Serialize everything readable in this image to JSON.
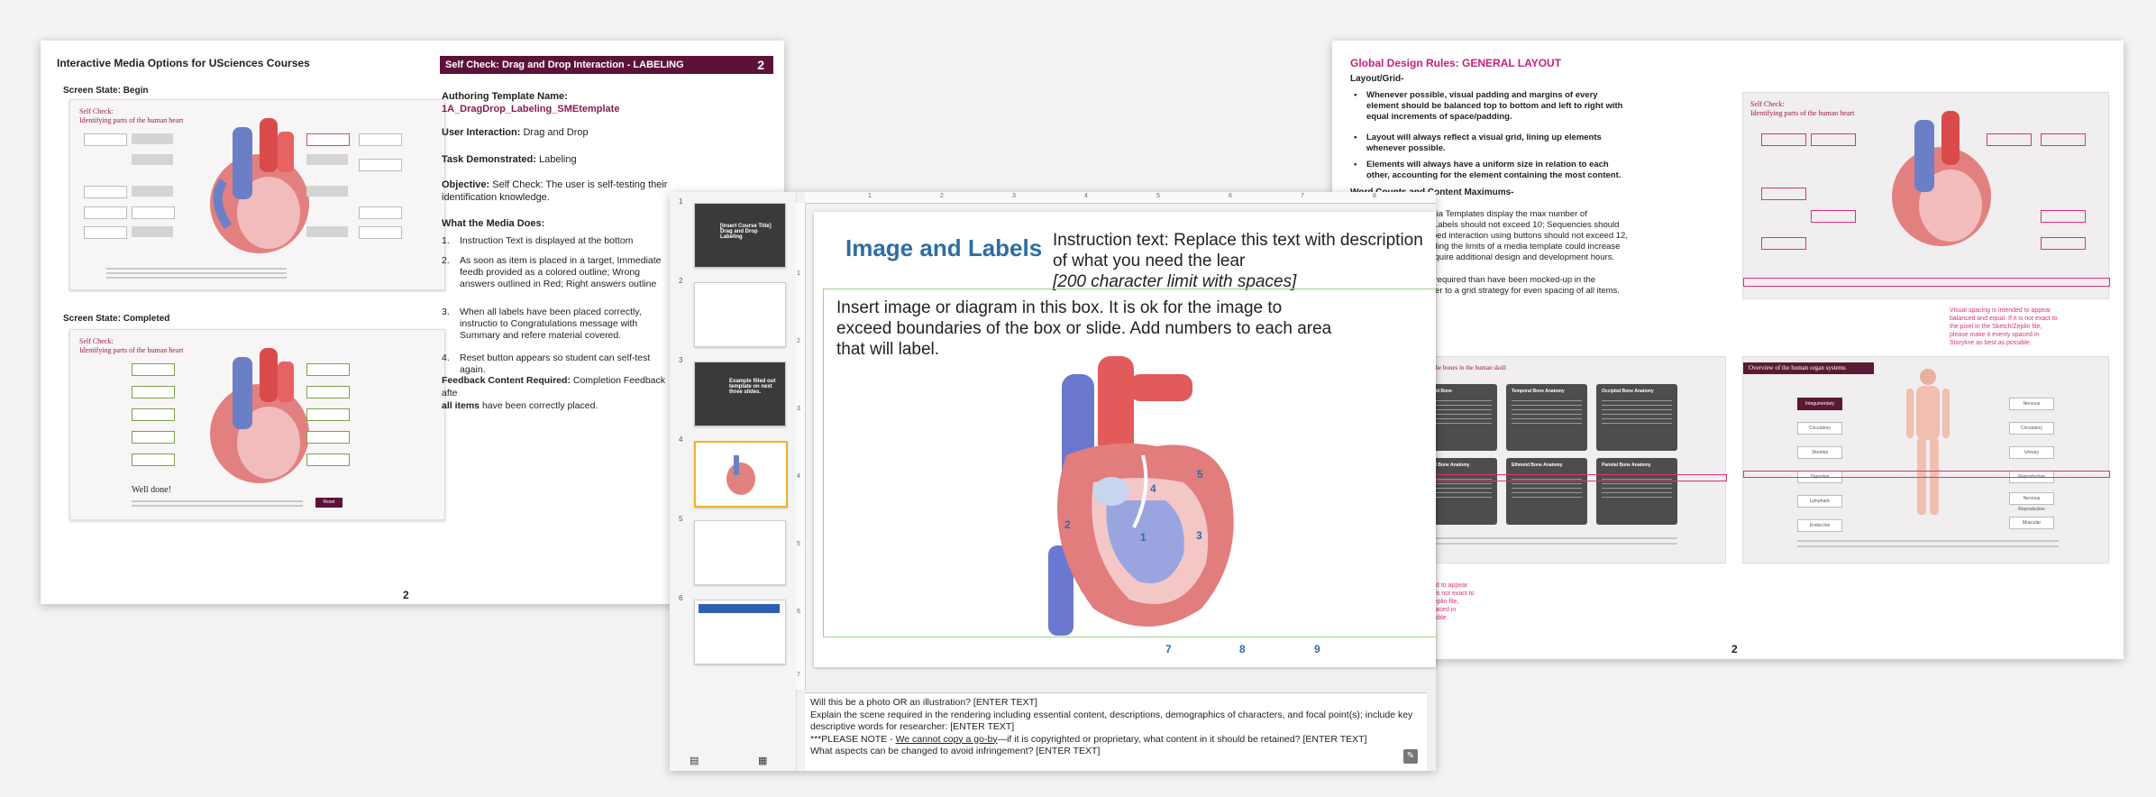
{
  "left_doc": {
    "title": "Interactive Media Options for USciences Courses",
    "screen_begin_label": "Screen State: Begin",
    "screen_completed_label": "Screen State: Completed",
    "thumb_title_line1": "Self Check:",
    "thumb_title_line2": "Identifying parts of the human heart",
    "well_done": "Well done!",
    "reset_label": "Reset",
    "section_header": "Self Check: Drag and Drop Interaction - LABELING",
    "section_number": "2",
    "authoring_label": "Authoring Template Name:",
    "authoring_value": "1A_DragDrop_Labeling_SMEtemplate",
    "user_interaction_label": "User Interaction:",
    "user_interaction_value": "Drag and Drop",
    "task_label": "Task Demonstrated:",
    "task_value": "Labeling",
    "objective_label": "Objective:",
    "objective_value": "Self Check: The user is self-testing their identification knowledge.",
    "media_does_label": "What the Media Does:",
    "list": [
      {
        "n": "1.",
        "text": "Instruction Text is displayed at the bottom"
      },
      {
        "n": "2.",
        "text": "As soon as item is placed in a target, Immediate feedb provided as a colored outline; Wrong answers outlined in Red; Right answers outline"
      },
      {
        "n": "3.",
        "text": "When all labels have been placed correctly, instructio to Congratulations message with Summary and refere material covered."
      },
      {
        "n": "4.",
        "text": "Reset button appears so student can self-test again."
      }
    ],
    "feedback_label": "Feedback Content Required:",
    "feedback_value": "Completion Feedback afte",
    "feedback_value2": "all items",
    "feedback_value3": "have been correctly placed.",
    "page_number": "2"
  },
  "right_doc": {
    "title": "Global Design Rules: GENERAL LAYOUT",
    "layout_grid": "Layout/Grid-",
    "bullets_bold": [
      "Whenever possible, visual padding and margins of every element should be balanced top to bottom and left to right with equal increments of space/padding.",
      "Layout will always reflect a visual grid, lining up elements whenever possible.",
      "Elements will always have a uniform size in relation to each other, accounting for the element containing the most content."
    ],
    "word_counts": "Word Counts and Content Maximums-",
    "bullets": [
      "Pre-designed Media Templates display the max number of interactive items: Labels should not exceed 10; Sequencies should not exceed 8, tabbed interaction using buttons should not exceed 12, and so on. Exceeding the limits of a media template could increase scope  and may require additional design and development hours.",
      "If fewer items are required than have been mocked-up in the template, then defer to a grid strategy for even spacing of all items."
    ],
    "spacing_note": "Visual spacing is intended to appear balanced and equal. If it is not exact to the pixel in the Sketch/Zeplin file, please make it evenly spaced in Storyline as best as possible.",
    "skull_title": "Self Check: Anatomy of the bones in the human skull",
    "bone_cards": [
      "Ethmoid Bone",
      "Temporal Bone Anatomy",
      "Occipital Bone Anatomy",
      "Frontal Bone Anatomy",
      "Ethmoid Bone Anatomy",
      "Parietal Bone Anatomy"
    ],
    "organ_title": "Overview of the human organ systems",
    "organ_left": [
      "Integumentary",
      "Circulatory",
      "Skeletal",
      "Digestive",
      "Lymphatic",
      "Endocrine"
    ],
    "organ_right": [
      "Nervous",
      "Circulatory",
      "Urinary",
      "Reproductive",
      "Nervous Reproductive",
      "Muscular"
    ],
    "page_number": "2"
  },
  "ppt": {
    "thumb1_text": "[Insert Course Title] Drag and Drop Labeling",
    "thumb3_text": "Example filled out template on next three slides.",
    "slide_numbers": [
      "1",
      "2",
      "3",
      "4",
      "5",
      "6"
    ],
    "ruler_h": [
      "1",
      "2",
      "3",
      "4",
      "5",
      "6",
      "7",
      "8"
    ],
    "ruler_v": [
      "1",
      "2",
      "3",
      "4",
      "5",
      "6",
      "7"
    ],
    "slide_title": "Image and Labels",
    "instruction_text": "Instruction text: Replace this text with description of what you need the lear",
    "instruction_limit": "[200 character limit with spaces]",
    "image_box_text": "Insert image or diagram in this box. It is ok for the image to exceed boundaries of the box or slide. Add numbers to each area that will label.",
    "heart_numbers": [
      "1",
      "2",
      "3",
      "4",
      "5"
    ],
    "bottom_numbers": [
      "7",
      "8",
      "9"
    ],
    "notes": {
      "line1": "Will this be a photo OR an illustration? [ENTER TEXT]",
      "line2": "Explain the scene required in the rendering including essential content, descriptions, demographics of characters, and focal point(s); include key descriptive words for researcher: [ENTER TEXT]",
      "line3a": "***PLEASE NOTE - ",
      "line3b": "We cannot copy a go-by",
      "line3c": "—if it is copyrighted or proprietary, what content in it should be retained? [ENTER TEXT]",
      "line4": "What aspects can be changed to avoid infringement? [ENTER TEXT]"
    }
  },
  "colors": {
    "maroon": "#5c1238",
    "pink": "#e0307f",
    "blue": "#2e6da4"
  }
}
